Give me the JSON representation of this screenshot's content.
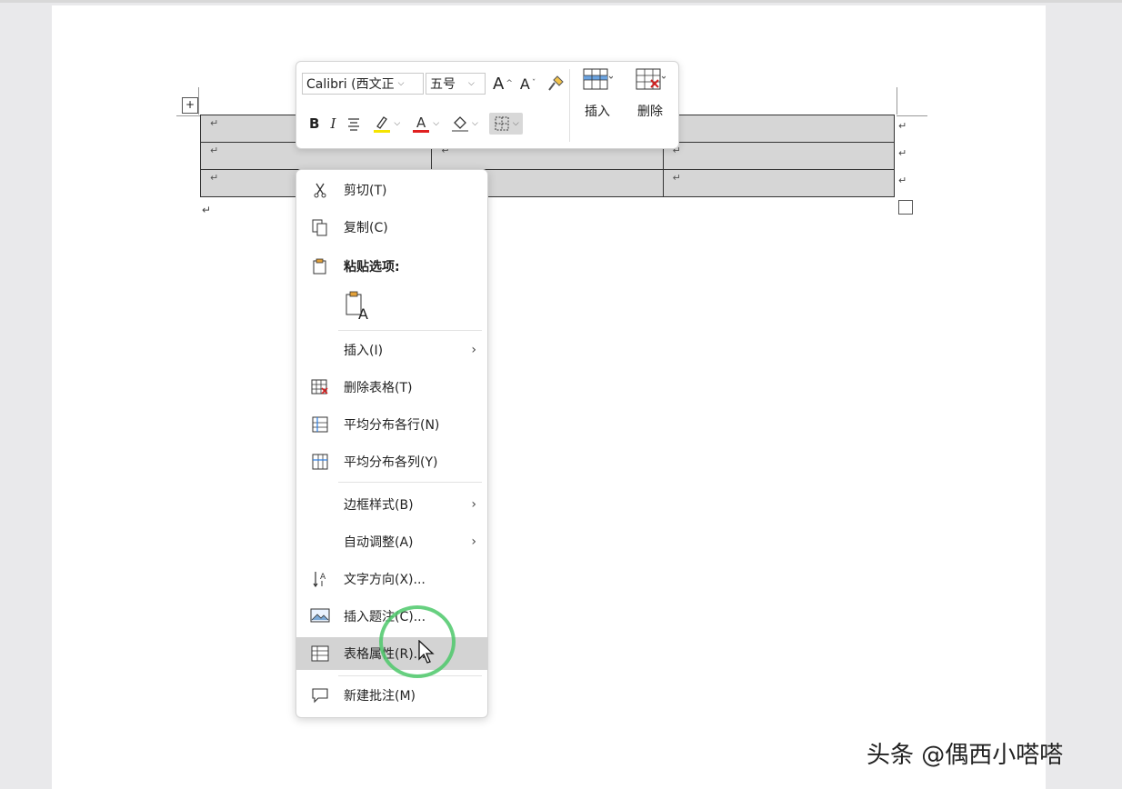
{
  "document": {
    "cell_mark": "↵",
    "para_mark": "↵",
    "table_move_handle": "+"
  },
  "mini_toolbar": {
    "font_name": "Calibri (西文正",
    "font_size": "五号",
    "grow_font": "A",
    "shrink_font": "A",
    "bold": "B",
    "italic": "I",
    "highlight_color": "#f5e400",
    "font_color": "#e02020",
    "insert_label": "插入",
    "delete_label": "删除"
  },
  "context_menu": {
    "items": [
      {
        "label": "剪切(T)",
        "icon": "scissors-icon"
      },
      {
        "label": "复制(C)",
        "icon": "copy-icon"
      },
      {
        "label": "粘贴选项:",
        "icon": "paste-icon"
      },
      {
        "label": "A",
        "icon": "paste-text-only-icon"
      },
      {
        "label": "插入(I)",
        "icon": ""
      },
      {
        "label": "删除表格(T)",
        "icon": "delete-table-icon"
      },
      {
        "label": "平均分布各行(N)",
        "icon": "distribute-rows-icon"
      },
      {
        "label": "平均分布各列(Y)",
        "icon": "distribute-columns-icon"
      },
      {
        "label": "边框样式(B)",
        "icon": ""
      },
      {
        "label": "自动调整(A)",
        "icon": ""
      },
      {
        "label": "文字方向(X)...",
        "icon": "text-direction-icon"
      },
      {
        "label": "插入题注(C)...",
        "icon": "insert-caption-icon"
      },
      {
        "label": "表格属性(R)...",
        "icon": "table-properties-icon"
      },
      {
        "label": "新建批注(M)",
        "icon": "new-comment-icon"
      }
    ],
    "submenu_arrow": "›"
  },
  "watermark": "头条 @偶西小嗒嗒"
}
